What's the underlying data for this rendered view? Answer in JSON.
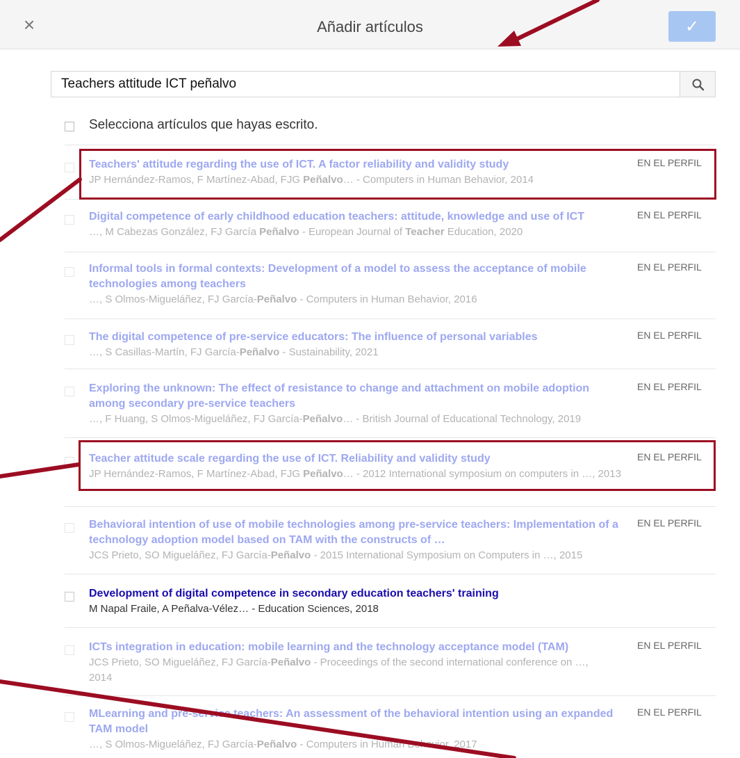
{
  "dialog": {
    "title": "Añadir artículos",
    "close_icon": "close-icon",
    "confirm_icon": "check-icon"
  },
  "search": {
    "value": "Teachers attitude ICT peñalvo",
    "button_icon": "search-icon"
  },
  "select_all_label": "Selecciona artículos que hayas escrito.",
  "articles": [
    {
      "title": "Teachers' attitude regarding the use of ICT. A factor reliability and validity study",
      "meta_before": "JP Hernández-Ramos, F Martínez-Abad, FJG ",
      "meta_bold": "Peñalvo",
      "meta_after": "… - Computers in Human Behavior, 2014",
      "badge": "EN EL PERFIL"
    },
    {
      "title": "Digital competence of early childhood education teachers: attitude, knowledge and use of ICT",
      "meta_before": "…, M Cabezas González, FJ García ",
      "meta_bold": "Peñalvo",
      "meta_mid": " - European Journal of ",
      "meta_bold2": "Teacher",
      "meta_after": " Education, 2020",
      "badge": "EN EL PERFIL"
    },
    {
      "title": "Informal tools in formal contexts: Development of a model to assess the acceptance of mobile technologies among teachers",
      "meta_before": "…, S Olmos-Migueláñez, FJ García-",
      "meta_bold": "Peñalvo",
      "meta_after": " - Computers in Human Behavior, 2016",
      "badge": "EN EL PERFIL"
    },
    {
      "title": "The digital competence of pre-service educators: The influence of personal variables",
      "meta_before": "…, S Casillas-Martín, FJ García-",
      "meta_bold": "Peñalvo",
      "meta_after": " - Sustainability, 2021",
      "badge": "EN EL PERFIL"
    },
    {
      "title": "Exploring the unknown: The effect of resistance to change and attachment on mobile adoption among secondary pre-service teachers",
      "meta_before": "…, F Huang, S Olmos-Migueláñez, FJ García-",
      "meta_bold": "Peñalvo",
      "meta_after": "… - British Journal of Educational Technology, 2019",
      "badge": "EN EL PERFIL"
    },
    {
      "title": "Teacher attitude scale regarding the use of ICT. Reliability and validity study",
      "meta_before": "JP Hernández-Ramos, F Martínez-Abad, FJG ",
      "meta_bold": "Peñalvo",
      "meta_after": "… - 2012 International symposium on computers in …, 2013",
      "badge": "EN EL PERFIL"
    },
    {
      "title": "Behavioral intention of use of mobile technologies among pre-service teachers: Implementation of a technology adoption model based on TAM with the constructs of …",
      "meta_before": "JCS Prieto, SO Migueláñez, FJ García-",
      "meta_bold": "Peñalvo",
      "meta_after": " - 2015 International Symposium on Computers in …, 2015",
      "badge": "EN EL PERFIL"
    },
    {
      "title": "Development of digital competence in secondary education teachers' training",
      "meta_before": "M Napal Fraile, A Peñalva-Vélez… - Education Sciences, 2018"
    },
    {
      "title": "ICTs integration in education: mobile learning and the technology acceptance model (TAM)",
      "meta_before": "JCS Prieto, SO Migueláñez, FJ García-",
      "meta_bold": "Peñalvo",
      "meta_after": " - Proceedings of the second international conference on …, 2014",
      "badge": "EN EL PERFIL"
    },
    {
      "title": "MLearning and pre-service teachers: An assessment of the behavioral intention using an expanded TAM model",
      "meta_before": "…, S Olmos-Migueláñez, FJ García-",
      "meta_bold": "Peñalvo",
      "meta_after": " - Computers in Human Behavior, 2017",
      "badge": "EN EL PERFIL"
    }
  ],
  "colors": {
    "annotation": "#9c0d22",
    "link_active": "#1a0dab",
    "link_faded": "#9da8f0",
    "confirm_button": "#a7c7f2"
  }
}
